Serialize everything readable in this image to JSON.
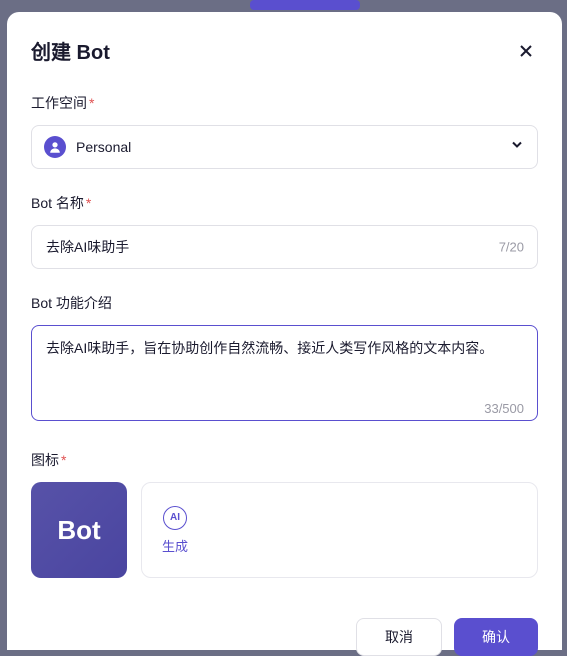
{
  "modal": {
    "title": "创建 Bot"
  },
  "form": {
    "workspace": {
      "label": "工作空间",
      "value": "Personal"
    },
    "botName": {
      "label": "Bot 名称",
      "value": "去除AI味助手",
      "count": "7/20"
    },
    "botDesc": {
      "label": "Bot 功能介绍",
      "value": "去除AI味助手，旨在协助创作自然流畅、接近人类写作风格的文本内容。",
      "count": "33/500"
    },
    "icon": {
      "label": "图标",
      "previewText": "Bot",
      "aiLabel": "AI",
      "genLabel": "生成"
    }
  },
  "footer": {
    "cancel": "取消",
    "confirm": "确认"
  }
}
